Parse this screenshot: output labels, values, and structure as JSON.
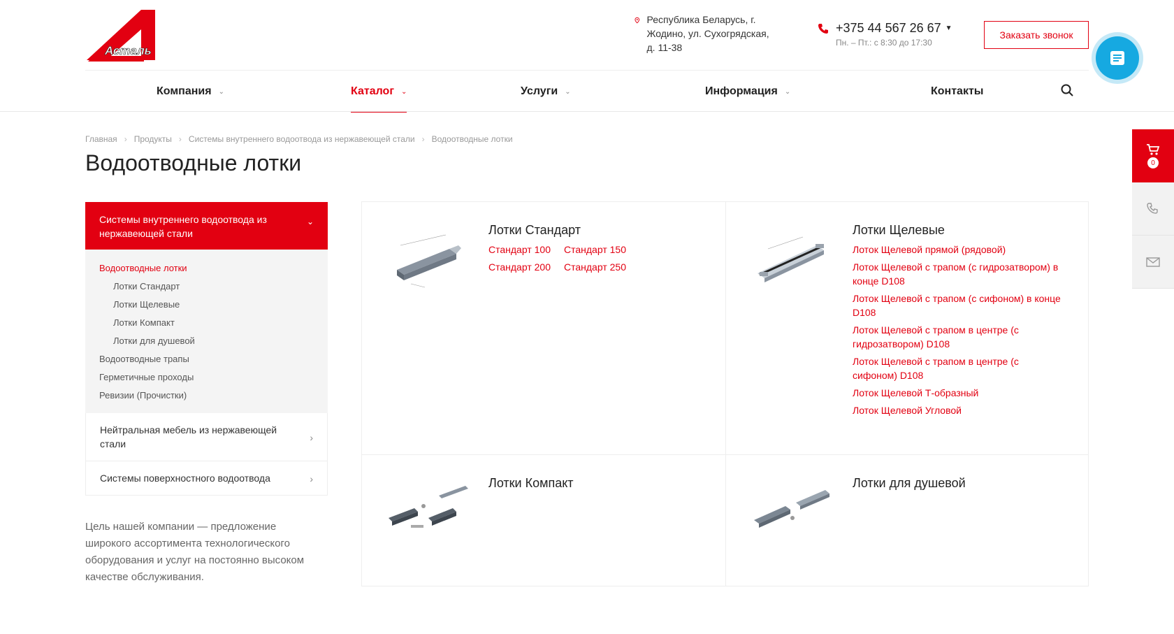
{
  "brand": {
    "logo_text": "Асталь",
    "accent": "#e20011",
    "chat_color": "#16a9e1"
  },
  "header": {
    "address": "Республика Беларусь, г. Жодино, ул. Сухогрядская, д. 11-38",
    "phone": "+375 44 567 26 67",
    "hours": "Пн. – Пт.: с 8:30 до 17:30",
    "callback_label": "Заказать звонок"
  },
  "nav": {
    "items": [
      {
        "label": "Компания",
        "has_dropdown": true
      },
      {
        "label": "Каталог",
        "has_dropdown": true,
        "active": true
      },
      {
        "label": "Услуги",
        "has_dropdown": true
      },
      {
        "label": "Информация",
        "has_dropdown": true
      },
      {
        "label": "Контакты",
        "has_dropdown": false
      }
    ]
  },
  "breadcrumb": [
    "Главная",
    "Продукты",
    "Системы внутреннего водоотвода из нержавеющей стали",
    "Водоотводные лотки"
  ],
  "page_title": "Водоотводные лотки",
  "sidebar": {
    "active_section": "Системы внутреннего водоотвода из нержавеющей стали",
    "sub_items": [
      {
        "label": "Водоотводные лотки",
        "current": true,
        "indent": false
      },
      {
        "label": "Лотки Стандарт",
        "indent": true
      },
      {
        "label": "Лотки Щелевые",
        "indent": true
      },
      {
        "label": "Лотки Компакт",
        "indent": true
      },
      {
        "label": "Лотки для душевой",
        "indent": true
      },
      {
        "label": "Водоотводные трапы",
        "indent": false
      },
      {
        "label": "Герметичные проходы",
        "indent": false
      },
      {
        "label": "Ревизии (Прочистки)",
        "indent": false
      }
    ],
    "sections": [
      "Нейтральная мебель из нержавеющей стали",
      "Системы поверхностного водоотвода"
    ]
  },
  "about_text": "Цель нашей компании — предложение широкого ассортимента технологического оборудования и услуг на постоянно высоком качестве обслуживания.",
  "products": [
    {
      "title": "Лотки Стандарт",
      "links": [
        "Стандарт 100",
        "Стандарт 150",
        "Стандарт 200",
        "Стандарт 250"
      ]
    },
    {
      "title": "Лотки Щелевые",
      "links": [
        "Лоток Щелевой прямой (рядовой)",
        "Лоток Щелевой с трапом (с гидрозатвором) в конце D108",
        "Лоток Щелевой с трапом (с сифоном) в конце D108",
        "Лоток Щелевой с трапом в центре (с гидрозатвором) D108",
        "Лоток Щелевой с трапом в центре (с сифоном) D108",
        "Лоток Щелевой Т-образный",
        "Лоток Щелевой Угловой"
      ]
    },
    {
      "title": "Лотки Компакт",
      "links": []
    },
    {
      "title": "Лотки для душевой",
      "links": []
    }
  ],
  "cart": {
    "count": "0"
  },
  "icons": [
    "location-pin-icon",
    "phone-icon",
    "chat-icon",
    "search-icon",
    "cart-icon",
    "phone-call-icon",
    "mail-icon",
    "chevron-down-icon",
    "chevron-right-icon"
  ]
}
